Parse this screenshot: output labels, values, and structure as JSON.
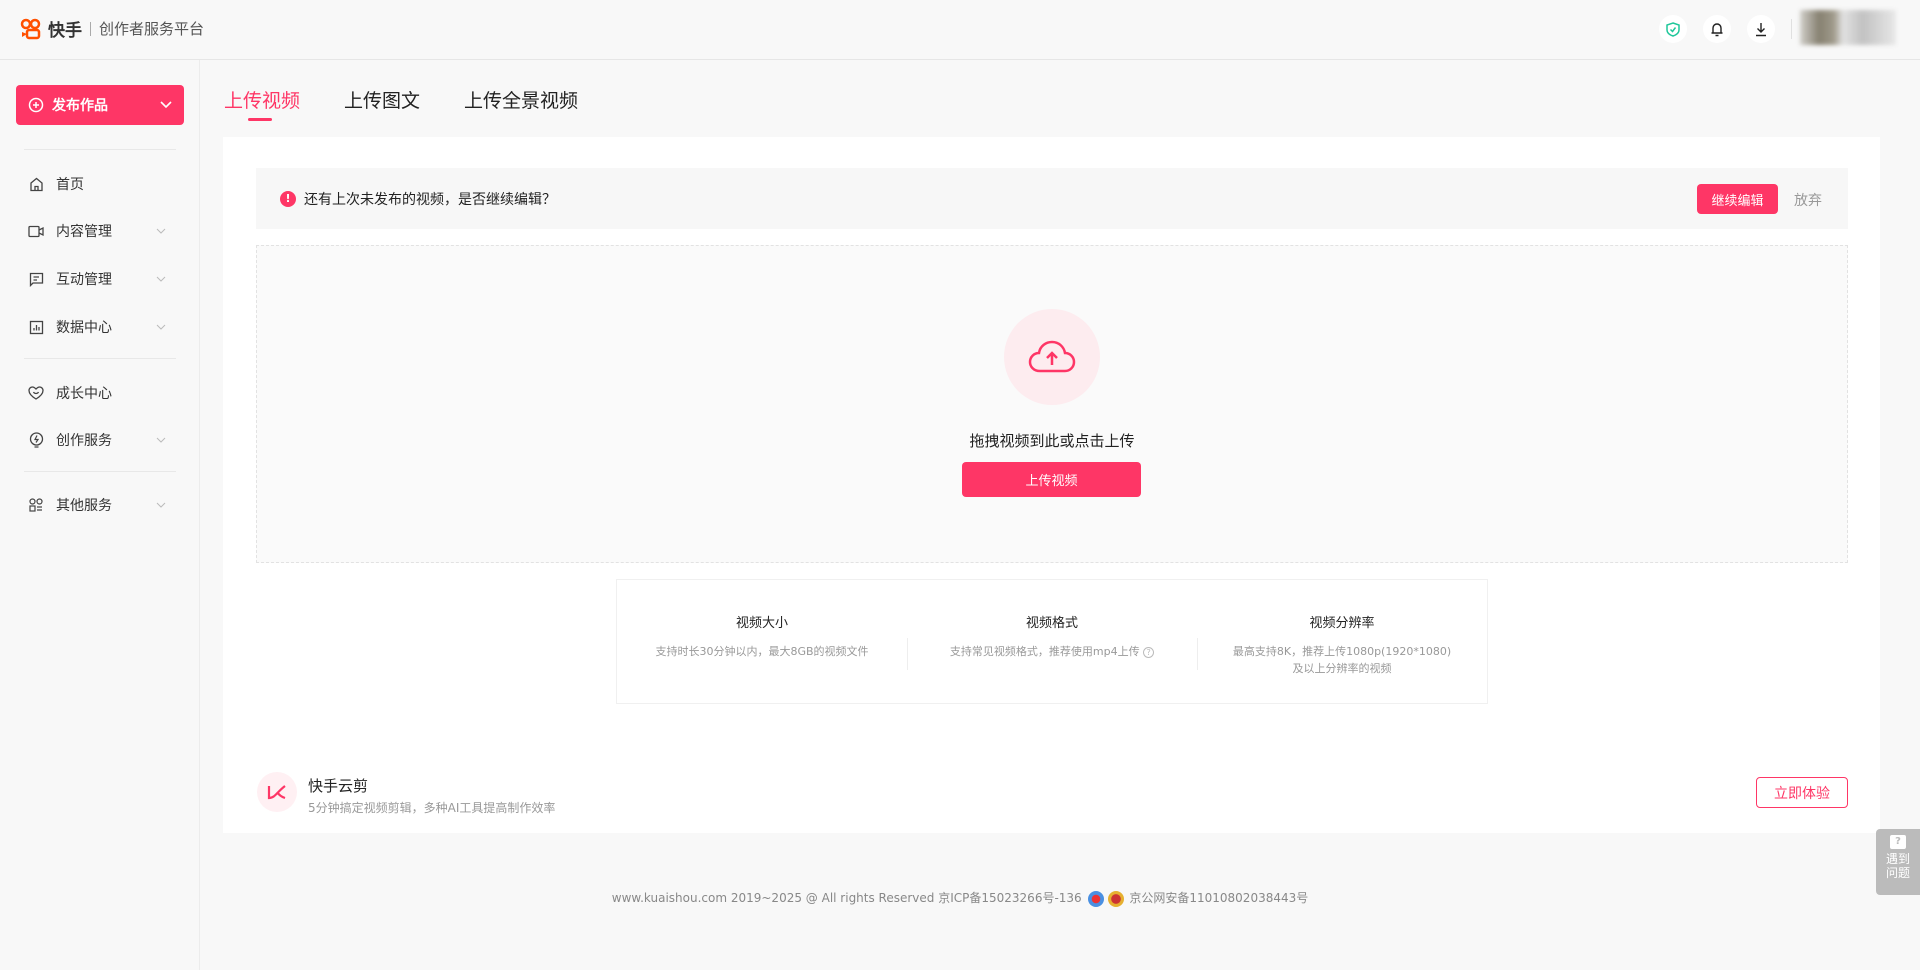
{
  "header": {
    "brand": "快手",
    "platform": "创作者服务平台",
    "icons": [
      "shield-check-icon",
      "bell-icon",
      "download-icon"
    ]
  },
  "sidebar": {
    "publish_label": "发布作品",
    "items": [
      {
        "label": "首页",
        "icon": "home-icon"
      },
      {
        "label": "内容管理",
        "icon": "video-icon"
      },
      {
        "label": "互动管理",
        "icon": "comment-icon"
      },
      {
        "label": "数据中心",
        "icon": "chart-icon"
      },
      {
        "label": "成长中心",
        "icon": "heart-icon"
      },
      {
        "label": "创作服务",
        "icon": "bulb-icon"
      },
      {
        "label": "其他服务",
        "icon": "apps-icon"
      }
    ]
  },
  "tabs": [
    {
      "label": "上传视频",
      "active": true
    },
    {
      "label": "上传图文"
    },
    {
      "label": "上传全景视频"
    }
  ],
  "notice": {
    "text": "还有上次未发布的视频，是否继续编辑？",
    "continue_label": "继续编辑",
    "discard_label": "放弃"
  },
  "upload": {
    "prompt": "拖拽视频到此或点击上传",
    "button_label": "上传视频"
  },
  "info": [
    {
      "title": "视频大小",
      "desc": "支持时长30分钟以内，最大8GB的视频文件"
    },
    {
      "title": "视频格式",
      "desc": "支持常见视频格式，推荐使用mp4上传"
    },
    {
      "title": "视频分辨率",
      "desc": "最高支持8K，推荐上传1080p(1920*1080)",
      "desc2": "及以上分辨率的视频"
    }
  ],
  "yunjian": {
    "title": "快手云剪",
    "subtitle": "5分钟搞定视频剪辑，多种AI工具提高制作效率",
    "button_label": "立即体验"
  },
  "footer": {
    "copyright": "www.kuaishou.com 2019~2025 @ All rights Reserved 京ICP备15023266号-136",
    "police": "京公网安备11010802038443号"
  },
  "help": {
    "line1": "遇到",
    "line2": "问题"
  },
  "colors": {
    "accent": "#fe3666",
    "shield": "#1fc79a"
  }
}
